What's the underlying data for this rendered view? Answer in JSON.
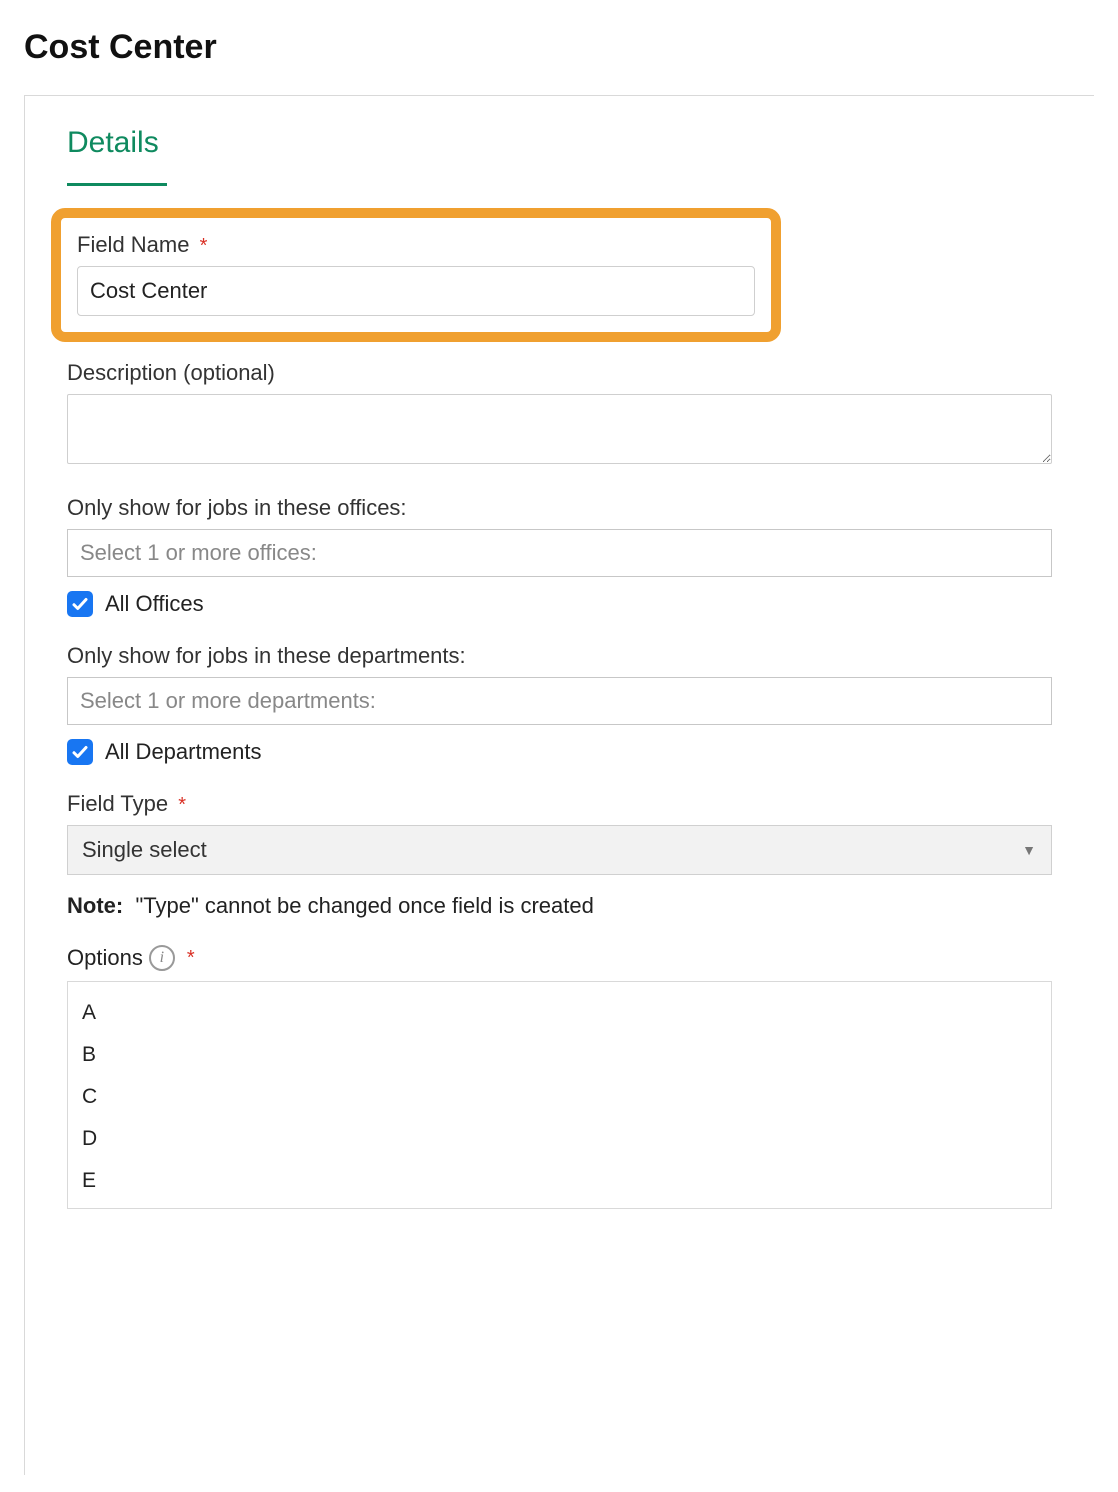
{
  "page_title": "Cost Center",
  "tabs": {
    "details_label": "Details"
  },
  "field_name": {
    "label": "Field Name",
    "value": "Cost Center"
  },
  "description": {
    "label": "Description (optional)",
    "value": ""
  },
  "offices": {
    "label": "Only show for jobs in these offices:",
    "placeholder": "Select 1 or more offices:",
    "checkbox_label": "All Offices",
    "checked": true
  },
  "departments": {
    "label": "Only show for jobs in these departments:",
    "placeholder": "Select 1 or more departments:",
    "checkbox_label": "All Departments",
    "checked": true
  },
  "field_type": {
    "label": "Field Type",
    "value": "Single select"
  },
  "note": {
    "prefix": "Note:",
    "text": "\"Type\" cannot be changed once field is created"
  },
  "options": {
    "label": "Options",
    "items": [
      "A",
      "B",
      "C",
      "D",
      "E"
    ]
  }
}
